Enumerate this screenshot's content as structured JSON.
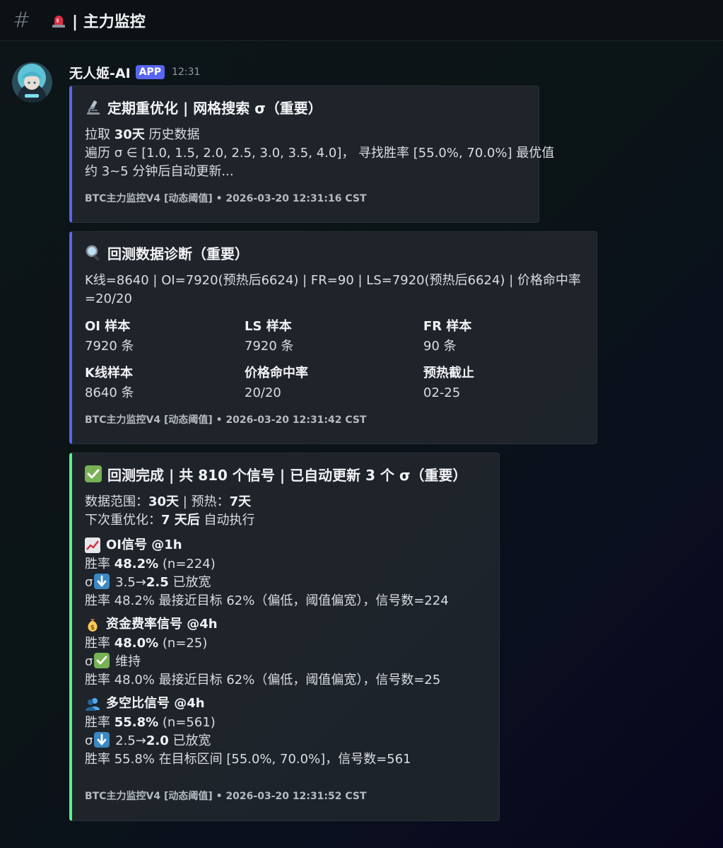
{
  "channel": {
    "hash": "#",
    "name": "| 主力监控"
  },
  "message": {
    "username": "无人姬-AI",
    "badge": "APP",
    "time": "12:31"
  },
  "embed1": {
    "title": "定期重优化 | 网格搜索 σ（重要）",
    "line1_pre": "拉取 ",
    "line1_bold": "30天",
    "line1_post": " 历史数据",
    "line2": "遍历 σ ∈ [1.0, 1.5, 2.0, 2.5, 3.0, 3.5, 4.0]， 寻找胜率 [55.0%, 70.0%] 最优值",
    "line3": "约 3~5 分钟后自动更新...",
    "footer": "BTC主力监控V4 [动态阈值] • 2026-03-20 12:31:16 CST"
  },
  "embed2": {
    "title": "回测数据诊断（重要）",
    "line1": "K线=8640 | OI=7920(预热后6624) | FR=90 | LS=7920(预热后6624) | 价格命中率",
    "line2": "=20/20",
    "fields": [
      {
        "name": "OI 样本",
        "value": "7920 条"
      },
      {
        "name": "LS 样本",
        "value": "7920 条"
      },
      {
        "name": "FR 样本",
        "value": "90 条"
      },
      {
        "name": "K线样本",
        "value": "8640 条"
      },
      {
        "name": "价格命中率",
        "value": "20/20"
      },
      {
        "name": "预热截止",
        "value": "02-25"
      }
    ],
    "footer": "BTC主力监控V4 [动态阈值] • 2026-03-20 12:31:42 CST"
  },
  "embed3": {
    "title": "回测完成 | 共 810 个信号 | 已自动更新 3 个 σ（重要）",
    "range_pre": "数据范围：",
    "range_days": "30天",
    "range_mid": " | 预热：",
    "range_warm": "7天",
    "next_pre": "下次重优化：",
    "next_bold": "7 天后",
    "next_post": " 自动执行",
    "signals": [
      {
        "title": "OI信号 @1h",
        "rate_pre": "胜率 ",
        "rate_bold": "48.2%",
        "rate_post": " (n=224)",
        "sigma_pre": "σ",
        "sigma_mid": " 3.5→",
        "sigma_bold": "2.5",
        "sigma_post": " 已放宽",
        "note": "胜率 48.2% 最接近目标 62%（偏低，阈值偏宽），信号数=224"
      },
      {
        "title": "资金费率信号 @4h",
        "rate_pre": "胜率 ",
        "rate_bold": "48.0%",
        "rate_post": " (n=25)",
        "sigma_pre": "σ",
        "sigma_post": " 维持",
        "note": "胜率 48.0% 最接近目标 62%（偏低，阈值偏宽），信号数=25"
      },
      {
        "title": "多空比信号 @4h",
        "rate_pre": "胜率 ",
        "rate_bold": "55.8%",
        "rate_post": " (n=561)",
        "sigma_pre": "σ",
        "sigma_mid": " 2.5→",
        "sigma_bold": "2.0",
        "sigma_post": " 已放宽",
        "note": "胜率 55.8% 在目标区间 [55.0%, 70.0%]，信号数=561"
      }
    ],
    "footer": "BTC主力监控V4 [动态阈值] • 2026-03-20 12:31:52 CST"
  },
  "colors": {
    "blurple": "#5865f2",
    "green": "#57f287",
    "emoji_blue": "#3b88c3",
    "emoji_green": "#77b255"
  }
}
